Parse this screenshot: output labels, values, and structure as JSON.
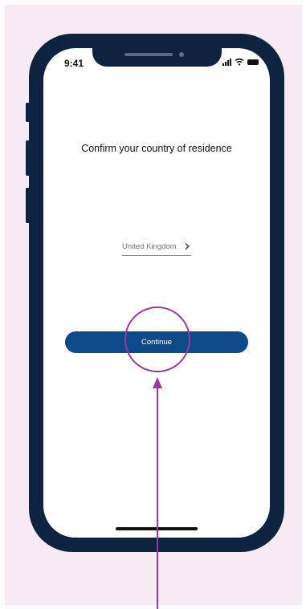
{
  "status_bar": {
    "time": "9:41"
  },
  "screen": {
    "title": "Confirm your country of residence",
    "country_field": {
      "value": "United Kingdom"
    },
    "continue_label": "Continue"
  },
  "colors": {
    "background": "#f7eaf3",
    "phone_frame": "#0e2340",
    "button": "#0e4a8a",
    "annotation": "#9b3a9e"
  },
  "icons": [
    "chevron-right-icon",
    "signal-icon",
    "wifi-icon",
    "battery-icon"
  ]
}
